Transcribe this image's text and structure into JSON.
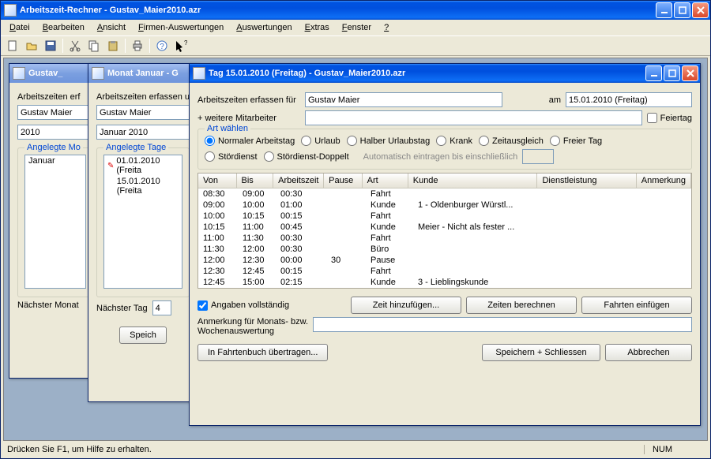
{
  "app": {
    "title": "Arbeitszeit-Rechner - Gustav_Maier2010.azr",
    "statusbar_left": "Drücken Sie F1, um Hilfe zu erhalten.",
    "statusbar_right": "NUM"
  },
  "menu": {
    "items": [
      "Datei",
      "Bearbeiten",
      "Ansicht",
      "Firmen-Auswertungen",
      "Auswertungen",
      "Extras",
      "Fenster",
      "?"
    ]
  },
  "toolbar_icons": [
    "new-icon",
    "open-icon",
    "save-icon",
    "cut-icon",
    "copy-icon",
    "paste-icon",
    "print-icon",
    "help-icon",
    "whatsthis-icon"
  ],
  "win_year": {
    "title": "Gustav_",
    "label_erfassen": "Arbeitszeiten erf",
    "name": "Gustav Maier",
    "year": "2010",
    "group_label": "Angelegte Mo",
    "month_item": "Januar",
    "next_label": "Nächster Monat"
  },
  "win_month": {
    "title": "Monat Januar - G",
    "label_erfassen": "Arbeitszeiten erfassen u",
    "name": "Gustav Maier",
    "month": "Januar 2010",
    "group_label": "Angelegte Tage",
    "days": [
      "01.01.2010 (Freita",
      "15.01.2010 (Freita"
    ],
    "next_label": "Nächster Tag",
    "next_value": "4",
    "save_btn": "Speich"
  },
  "win_day": {
    "title": "Tag 15.01.2010 (Freitag) - Gustav_Maier2010.azr",
    "label_erfassen": "Arbeitszeiten erfassen für",
    "name": "Gustav Maier",
    "am_label": "am",
    "date": "15.01.2010 (Freitag)",
    "more_label": "+ weitere Mitarbeiter",
    "more_value": "",
    "holiday_label": "Feiertag",
    "group_label": "Art wählen",
    "radio_options": [
      "Normaler Arbeitstag",
      "Urlaub",
      "Halber Urlaubstag",
      "Krank",
      "Zeitausgleich",
      "Freier Tag",
      "Stördienst",
      "Stördienst-Doppelt"
    ],
    "radio_selected": 0,
    "auto_label": "Automatisch eintragen bis einschließlich",
    "auto_value": "",
    "columns": [
      "Von",
      "Bis",
      "Arbeitszeit",
      "Pause",
      "Art",
      "Kunde",
      "Dienstleistung",
      "Anmerkung"
    ],
    "rows": [
      {
        "von": "08:30",
        "bis": "09:00",
        "arb": "00:30",
        "pause": "",
        "art": "Fahrt",
        "kunde": "",
        "dienst": "",
        "anm": ""
      },
      {
        "von": "09:00",
        "bis": "10:00",
        "arb": "01:00",
        "pause": "",
        "art": "Kunde",
        "kunde": "1 - Oldenburger Würstl...",
        "dienst": "",
        "anm": ""
      },
      {
        "von": "10:00",
        "bis": "10:15",
        "arb": "00:15",
        "pause": "",
        "art": "Fahrt",
        "kunde": "",
        "dienst": "",
        "anm": ""
      },
      {
        "von": "10:15",
        "bis": "11:00",
        "arb": "00:45",
        "pause": "",
        "art": "Kunde",
        "kunde": "Meier - Nicht als fester ...",
        "dienst": "",
        "anm": ""
      },
      {
        "von": "11:00",
        "bis": "11:30",
        "arb": "00:30",
        "pause": "",
        "art": "Fahrt",
        "kunde": "",
        "dienst": "",
        "anm": ""
      },
      {
        "von": "11:30",
        "bis": "12:00",
        "arb": "00:30",
        "pause": "",
        "art": "Büro",
        "kunde": "",
        "dienst": "",
        "anm": ""
      },
      {
        "von": "12:00",
        "bis": "12:30",
        "arb": "00:00",
        "pause": "30",
        "art": "Pause",
        "kunde": "",
        "dienst": "",
        "anm": ""
      },
      {
        "von": "12:30",
        "bis": "12:45",
        "arb": "00:15",
        "pause": "",
        "art": "Fahrt",
        "kunde": "",
        "dienst": "",
        "anm": ""
      },
      {
        "von": "12:45",
        "bis": "15:00",
        "arb": "02:15",
        "pause": "",
        "art": "Kunde",
        "kunde": "3 - Lieblingskunde",
        "dienst": "",
        "anm": ""
      }
    ],
    "complete_label": "Angaben vollständig",
    "add_time_btn": "Zeit hinzufügen...",
    "calc_btn": "Zeiten berechnen",
    "trips_btn": "Fahrten einfügen",
    "note_label1": "Anmerkung für Monats- bzw.",
    "note_label2": "Wochenauswertung",
    "note_value": "",
    "transfer_btn": "In Fahrtenbuch übertragen...",
    "save_btn": "Speichern + Schliessen",
    "cancel_btn": "Abbrechen"
  }
}
